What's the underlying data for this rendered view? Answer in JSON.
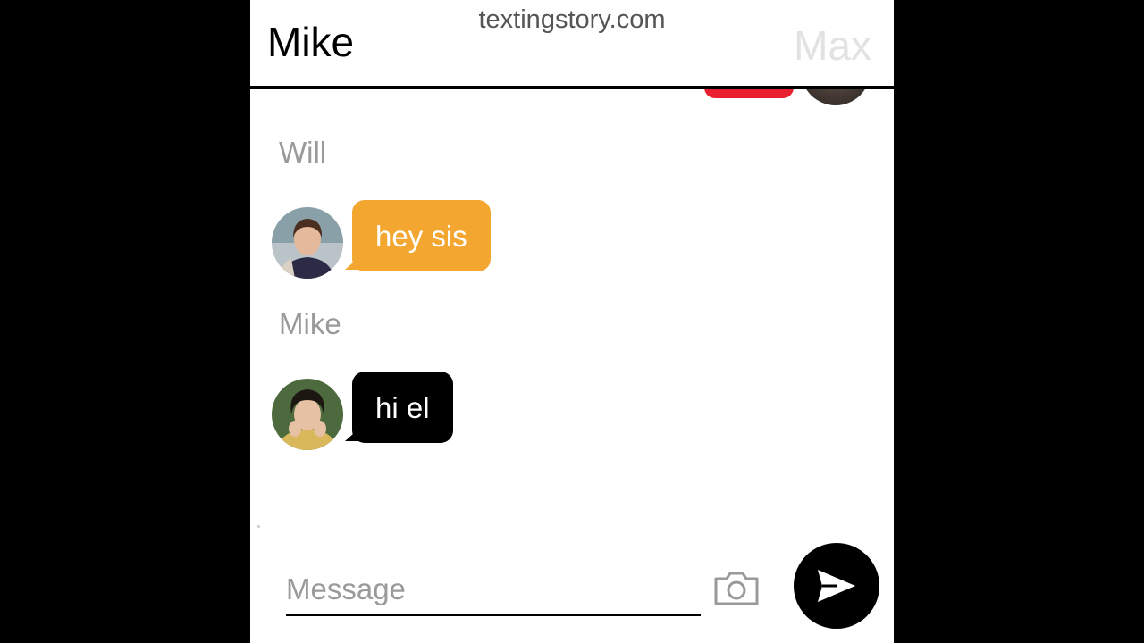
{
  "header": {
    "title": "Mike",
    "watermark": "textingstory.com",
    "right_label": "Max"
  },
  "messages": [
    {
      "sender": "Will",
      "text": "hey sis",
      "bubble_color": "#f3a630",
      "avatar": "will-avatar"
    },
    {
      "sender": "Mike",
      "text": "hi el",
      "bubble_color": "#000000",
      "avatar": "mike-avatar"
    }
  ],
  "previous_message": {
    "bubble_color": "#e8202f"
  },
  "composer": {
    "placeholder": "Message",
    "value": "",
    "camera_icon": "camera-icon",
    "send_icon": "send-icon"
  }
}
